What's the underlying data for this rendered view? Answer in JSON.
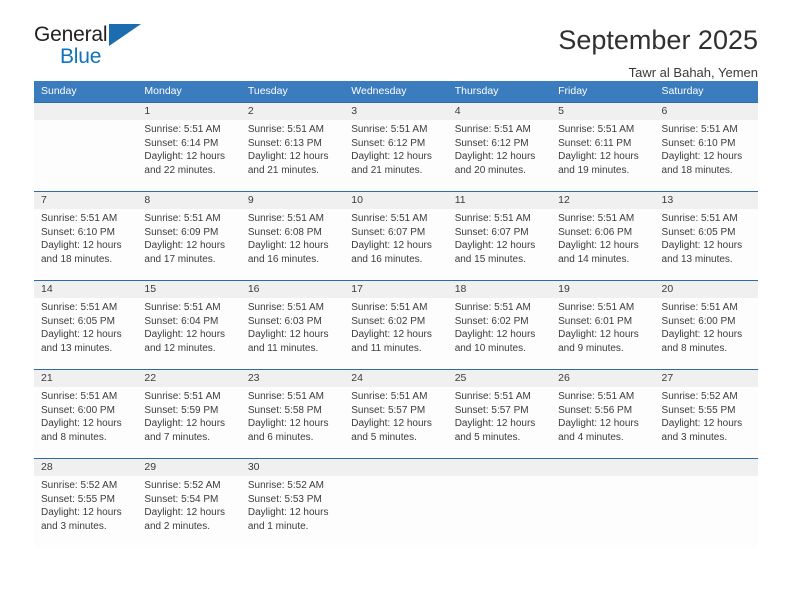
{
  "brand": {
    "name_part1": "General",
    "name_part2": "Blue",
    "triangle_color": "#1c6cb0",
    "blue_color": "#1073bd"
  },
  "header": {
    "title": "September 2025",
    "location": "Tawr al Bahah, Yemen"
  },
  "colors": {
    "header_row_bg": "#3a7cbe",
    "daynum_bg": "#f0f0f0",
    "separator": "#2c6ca8",
    "text": "#3c3c3c"
  },
  "weekdays": [
    "Sunday",
    "Monday",
    "Tuesday",
    "Wednesday",
    "Thursday",
    "Friday",
    "Saturday"
  ],
  "weeks": [
    {
      "days": [
        {
          "num": "",
          "sunrise": "",
          "sunset": "",
          "daylight1": "",
          "daylight2": "",
          "empty": true
        },
        {
          "num": "1",
          "sunrise": "Sunrise: 5:51 AM",
          "sunset": "Sunset: 6:14 PM",
          "daylight1": "Daylight: 12 hours",
          "daylight2": "and 22 minutes.",
          "empty": false
        },
        {
          "num": "2",
          "sunrise": "Sunrise: 5:51 AM",
          "sunset": "Sunset: 6:13 PM",
          "daylight1": "Daylight: 12 hours",
          "daylight2": "and 21 minutes.",
          "empty": false
        },
        {
          "num": "3",
          "sunrise": "Sunrise: 5:51 AM",
          "sunset": "Sunset: 6:12 PM",
          "daylight1": "Daylight: 12 hours",
          "daylight2": "and 21 minutes.",
          "empty": false
        },
        {
          "num": "4",
          "sunrise": "Sunrise: 5:51 AM",
          "sunset": "Sunset: 6:12 PM",
          "daylight1": "Daylight: 12 hours",
          "daylight2": "and 20 minutes.",
          "empty": false
        },
        {
          "num": "5",
          "sunrise": "Sunrise: 5:51 AM",
          "sunset": "Sunset: 6:11 PM",
          "daylight1": "Daylight: 12 hours",
          "daylight2": "and 19 minutes.",
          "empty": false
        },
        {
          "num": "6",
          "sunrise": "Sunrise: 5:51 AM",
          "sunset": "Sunset: 6:10 PM",
          "daylight1": "Daylight: 12 hours",
          "daylight2": "and 18 minutes.",
          "empty": false
        }
      ]
    },
    {
      "days": [
        {
          "num": "7",
          "sunrise": "Sunrise: 5:51 AM",
          "sunset": "Sunset: 6:10 PM",
          "daylight1": "Daylight: 12 hours",
          "daylight2": "and 18 minutes.",
          "empty": false
        },
        {
          "num": "8",
          "sunrise": "Sunrise: 5:51 AM",
          "sunset": "Sunset: 6:09 PM",
          "daylight1": "Daylight: 12 hours",
          "daylight2": "and 17 minutes.",
          "empty": false
        },
        {
          "num": "9",
          "sunrise": "Sunrise: 5:51 AM",
          "sunset": "Sunset: 6:08 PM",
          "daylight1": "Daylight: 12 hours",
          "daylight2": "and 16 minutes.",
          "empty": false
        },
        {
          "num": "10",
          "sunrise": "Sunrise: 5:51 AM",
          "sunset": "Sunset: 6:07 PM",
          "daylight1": "Daylight: 12 hours",
          "daylight2": "and 16 minutes.",
          "empty": false
        },
        {
          "num": "11",
          "sunrise": "Sunrise: 5:51 AM",
          "sunset": "Sunset: 6:07 PM",
          "daylight1": "Daylight: 12 hours",
          "daylight2": "and 15 minutes.",
          "empty": false
        },
        {
          "num": "12",
          "sunrise": "Sunrise: 5:51 AM",
          "sunset": "Sunset: 6:06 PM",
          "daylight1": "Daylight: 12 hours",
          "daylight2": "and 14 minutes.",
          "empty": false
        },
        {
          "num": "13",
          "sunrise": "Sunrise: 5:51 AM",
          "sunset": "Sunset: 6:05 PM",
          "daylight1": "Daylight: 12 hours",
          "daylight2": "and 13 minutes.",
          "empty": false
        }
      ]
    },
    {
      "days": [
        {
          "num": "14",
          "sunrise": "Sunrise: 5:51 AM",
          "sunset": "Sunset: 6:05 PM",
          "daylight1": "Daylight: 12 hours",
          "daylight2": "and 13 minutes.",
          "empty": false
        },
        {
          "num": "15",
          "sunrise": "Sunrise: 5:51 AM",
          "sunset": "Sunset: 6:04 PM",
          "daylight1": "Daylight: 12 hours",
          "daylight2": "and 12 minutes.",
          "empty": false
        },
        {
          "num": "16",
          "sunrise": "Sunrise: 5:51 AM",
          "sunset": "Sunset: 6:03 PM",
          "daylight1": "Daylight: 12 hours",
          "daylight2": "and 11 minutes.",
          "empty": false
        },
        {
          "num": "17",
          "sunrise": "Sunrise: 5:51 AM",
          "sunset": "Sunset: 6:02 PM",
          "daylight1": "Daylight: 12 hours",
          "daylight2": "and 11 minutes.",
          "empty": false
        },
        {
          "num": "18",
          "sunrise": "Sunrise: 5:51 AM",
          "sunset": "Sunset: 6:02 PM",
          "daylight1": "Daylight: 12 hours",
          "daylight2": "and 10 minutes.",
          "empty": false
        },
        {
          "num": "19",
          "sunrise": "Sunrise: 5:51 AM",
          "sunset": "Sunset: 6:01 PM",
          "daylight1": "Daylight: 12 hours",
          "daylight2": "and 9 minutes.",
          "empty": false
        },
        {
          "num": "20",
          "sunrise": "Sunrise: 5:51 AM",
          "sunset": "Sunset: 6:00 PM",
          "daylight1": "Daylight: 12 hours",
          "daylight2": "and 8 minutes.",
          "empty": false
        }
      ]
    },
    {
      "days": [
        {
          "num": "21",
          "sunrise": "Sunrise: 5:51 AM",
          "sunset": "Sunset: 6:00 PM",
          "daylight1": "Daylight: 12 hours",
          "daylight2": "and 8 minutes.",
          "empty": false
        },
        {
          "num": "22",
          "sunrise": "Sunrise: 5:51 AM",
          "sunset": "Sunset: 5:59 PM",
          "daylight1": "Daylight: 12 hours",
          "daylight2": "and 7 minutes.",
          "empty": false
        },
        {
          "num": "23",
          "sunrise": "Sunrise: 5:51 AM",
          "sunset": "Sunset: 5:58 PM",
          "daylight1": "Daylight: 12 hours",
          "daylight2": "and 6 minutes.",
          "empty": false
        },
        {
          "num": "24",
          "sunrise": "Sunrise: 5:51 AM",
          "sunset": "Sunset: 5:57 PM",
          "daylight1": "Daylight: 12 hours",
          "daylight2": "and 5 minutes.",
          "empty": false
        },
        {
          "num": "25",
          "sunrise": "Sunrise: 5:51 AM",
          "sunset": "Sunset: 5:57 PM",
          "daylight1": "Daylight: 12 hours",
          "daylight2": "and 5 minutes.",
          "empty": false
        },
        {
          "num": "26",
          "sunrise": "Sunrise: 5:51 AM",
          "sunset": "Sunset: 5:56 PM",
          "daylight1": "Daylight: 12 hours",
          "daylight2": "and 4 minutes.",
          "empty": false
        },
        {
          "num": "27",
          "sunrise": "Sunrise: 5:52 AM",
          "sunset": "Sunset: 5:55 PM",
          "daylight1": "Daylight: 12 hours",
          "daylight2": "and 3 minutes.",
          "empty": false
        }
      ]
    },
    {
      "days": [
        {
          "num": "28",
          "sunrise": "Sunrise: 5:52 AM",
          "sunset": "Sunset: 5:55 PM",
          "daylight1": "Daylight: 12 hours",
          "daylight2": "and 3 minutes.",
          "empty": false
        },
        {
          "num": "29",
          "sunrise": "Sunrise: 5:52 AM",
          "sunset": "Sunset: 5:54 PM",
          "daylight1": "Daylight: 12 hours",
          "daylight2": "and 2 minutes.",
          "empty": false
        },
        {
          "num": "30",
          "sunrise": "Sunrise: 5:52 AM",
          "sunset": "Sunset: 5:53 PM",
          "daylight1": "Daylight: 12 hours",
          "daylight2": "and 1 minute.",
          "empty": false
        },
        {
          "num": "",
          "sunrise": "",
          "sunset": "",
          "daylight1": "",
          "daylight2": "",
          "empty": true
        },
        {
          "num": "",
          "sunrise": "",
          "sunset": "",
          "daylight1": "",
          "daylight2": "",
          "empty": true
        },
        {
          "num": "",
          "sunrise": "",
          "sunset": "",
          "daylight1": "",
          "daylight2": "",
          "empty": true
        },
        {
          "num": "",
          "sunrise": "",
          "sunset": "",
          "daylight1": "",
          "daylight2": "",
          "empty": true
        }
      ]
    }
  ]
}
